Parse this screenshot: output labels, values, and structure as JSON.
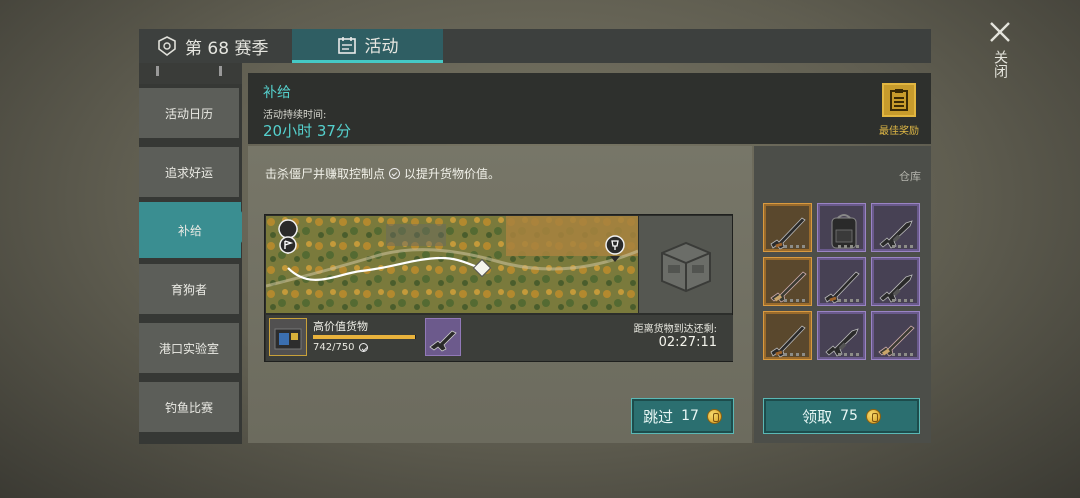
{
  "tabs": [
    {
      "label": "第 68 赛季",
      "icon": "season-badge-icon",
      "active": false
    },
    {
      "label": "活动",
      "icon": "calendar-icon",
      "active": true
    }
  ],
  "close": {
    "label": "关闭",
    "icon": "close-icon"
  },
  "sidebar": {
    "items": [
      {
        "label": "活动日历",
        "active": false
      },
      {
        "label": "追求好运",
        "active": false
      },
      {
        "label": "补给",
        "active": true
      },
      {
        "label": "育狗者",
        "active": false
      },
      {
        "label": "港口实验室",
        "active": false
      },
      {
        "label": "钓鱼比赛",
        "active": false
      }
    ]
  },
  "header": {
    "title": "补给",
    "duration_label": "活动持续时间:",
    "duration_value": "20小时 37分",
    "best_reward_label": "最佳奖励",
    "best_reward_icon": "clipboard-icon"
  },
  "main": {
    "instruction_prefix": "击杀僵尸并赚取控制点",
    "instruction_suffix": "以提升货物价值。",
    "cargo": {
      "name": "高价值货物",
      "count": "742/750",
      "progress": 0.99
    },
    "eta": {
      "label": "距离货物到达还剩:",
      "value": "02:27:11"
    },
    "skip_button": {
      "label": "跳过",
      "cost": "17"
    }
  },
  "warehouse": {
    "label": "仓库",
    "slots": [
      {
        "icon": "shotgun-icon",
        "rarity": "orange"
      },
      {
        "icon": "backpack-icon",
        "rarity": "purple"
      },
      {
        "icon": "assault-rifle-icon",
        "rarity": "purple"
      },
      {
        "icon": "rifle-icon",
        "rarity": "orange"
      },
      {
        "icon": "shotgun-icon",
        "rarity": "purple"
      },
      {
        "icon": "assault-rifle-icon",
        "rarity": "purple"
      },
      {
        "icon": "shotgun-icon",
        "rarity": "orange"
      },
      {
        "icon": "assault-rifle-icon",
        "rarity": "purple"
      },
      {
        "icon": "rifle-icon",
        "rarity": "purple"
      }
    ],
    "claim_button": {
      "label": "领取",
      "cost": "75"
    }
  },
  "colors": {
    "accent": "#55d0cd",
    "button": "#2b6f70",
    "gold": "#e0b845",
    "rarity_orange": "#9a6b2c",
    "rarity_purple": "#6a5a8c"
  }
}
